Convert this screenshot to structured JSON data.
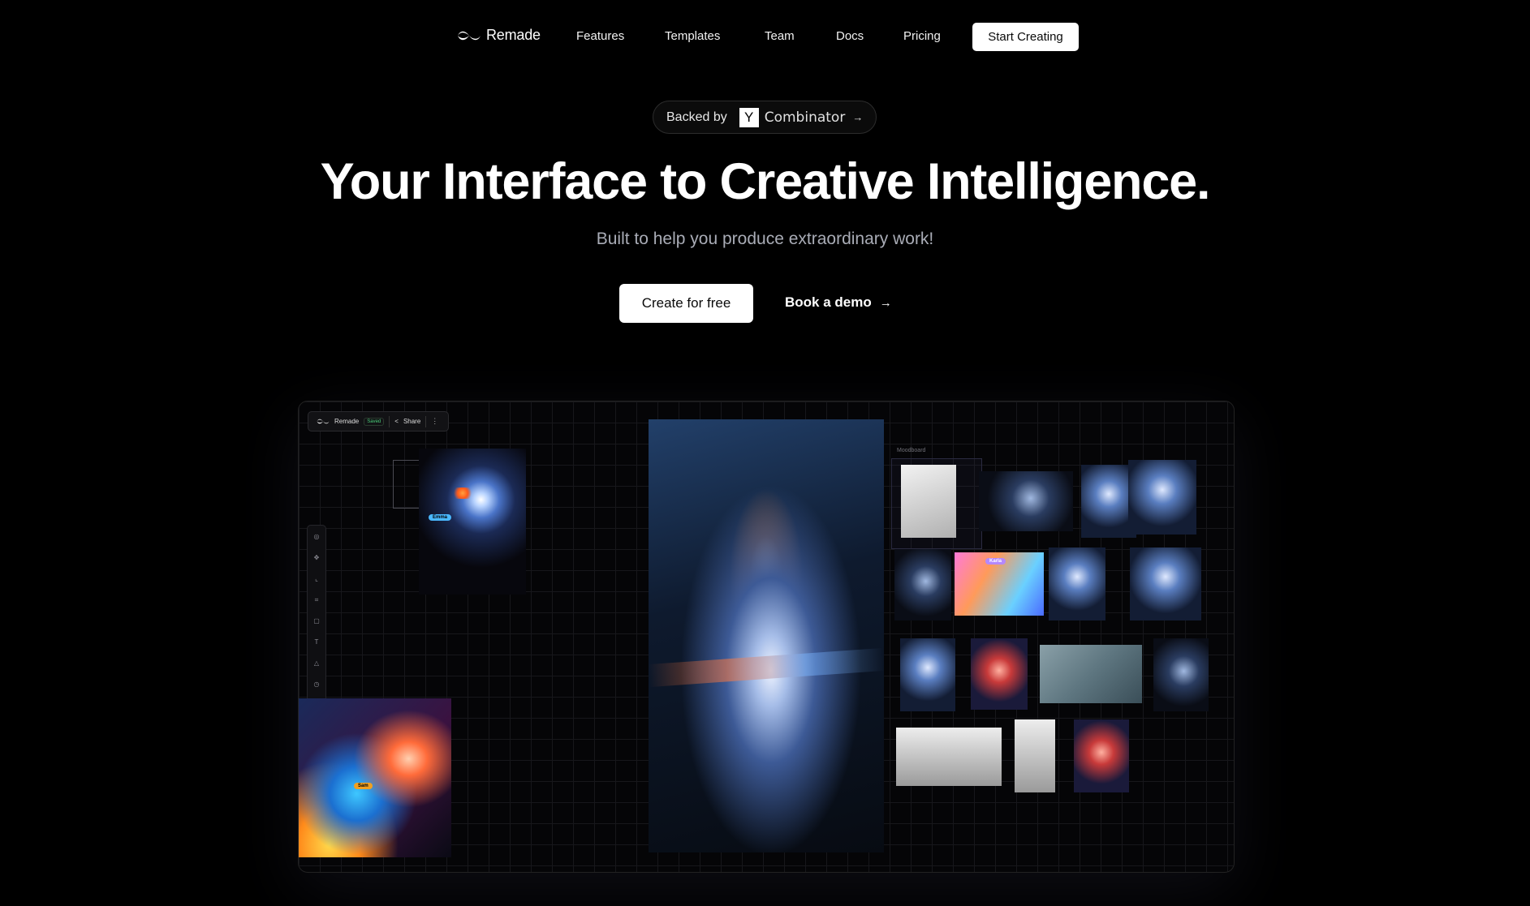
{
  "nav": {
    "logo_text": "Remade",
    "links": [
      "Features",
      "Templates",
      "Team",
      "Docs",
      "Pricing"
    ],
    "cta_label": "Start Creating"
  },
  "badge": {
    "prefix": "Backed by",
    "yc_letter": "Y",
    "yc_name": "Combinator",
    "arrow_icon": "arrow-right-icon"
  },
  "hero": {
    "title": "Your Interface to Creative Intelligence.",
    "subtitle": "Built to help you produce extraordinary work!",
    "primary_button": "Create for free",
    "secondary_button": "Book a demo"
  },
  "preview": {
    "toolbar": {
      "app_name": "Remade",
      "saved_badge": "Saved",
      "share_label": "Share",
      "more_icon": "more-vertical-icon"
    },
    "sidebar_icons": [
      "select-icon",
      "move-icon",
      "crop-icon",
      "grid-icon",
      "frame-icon",
      "text-icon",
      "shape-icon",
      "history-icon",
      "avatar-icon"
    ],
    "moodboard_label": "Moodboard",
    "cursor_tags": [
      "Emma",
      "Karla",
      "Sam"
    ]
  },
  "colors": {
    "background": "#000000",
    "text_primary": "#ffffff",
    "text_muted": "#a9acb6",
    "button_bg": "#ffffff",
    "button_text": "#0a0a0a"
  }
}
